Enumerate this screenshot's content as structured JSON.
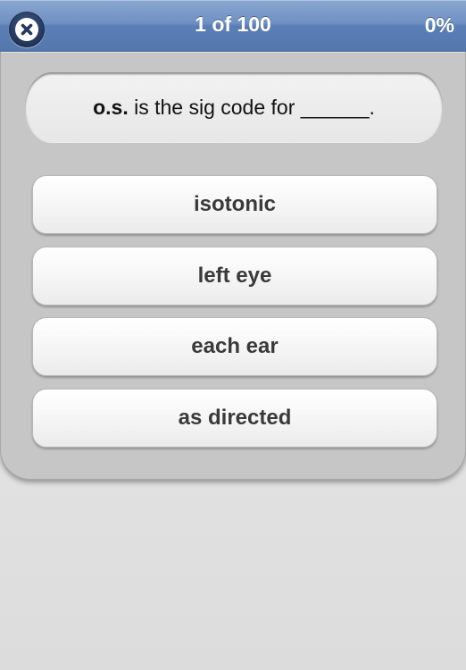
{
  "header": {
    "close_icon": "close-x-icon",
    "title": "1 of 100",
    "progress": "0%"
  },
  "question": {
    "term": "o.s.",
    "text": " is the sig code for ______."
  },
  "answers": [
    {
      "label": "isotonic"
    },
    {
      "label": "left eye"
    },
    {
      "label": "each ear"
    },
    {
      "label": "as directed"
    }
  ],
  "colors": {
    "navbar": "#6e90c2",
    "close_button": "#23365a",
    "card": "#c6c6c6",
    "background": "#e0e0e0"
  }
}
